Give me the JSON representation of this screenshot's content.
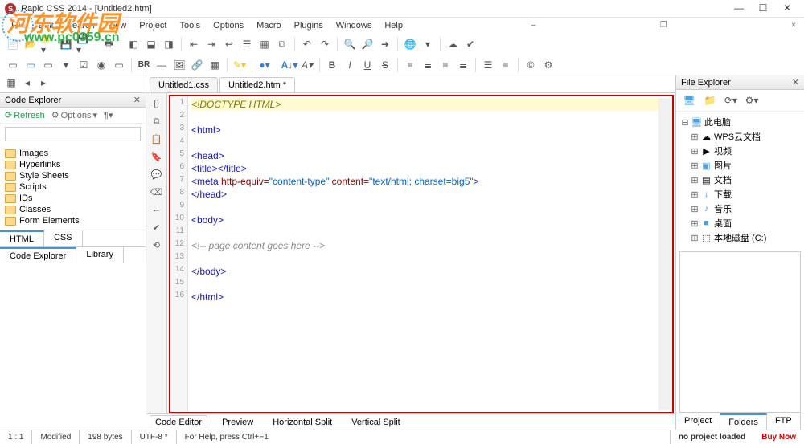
{
  "watermark": {
    "main": "河东软件园",
    "sub": "www.pc0359.cn"
  },
  "window": {
    "app_icon": "S",
    "title": "Rapid CSS 2014 - [Untitled2.htm]",
    "buttons": {
      "min": "—",
      "max": "☐",
      "close": "✕"
    },
    "subbuttons": {
      "min": "–",
      "max": "❐",
      "close": "×"
    }
  },
  "menus": [
    "File",
    "Edit",
    "Search",
    "View",
    "Project",
    "Tools",
    "Options",
    "Macro",
    "Plugins",
    "Windows",
    "Help"
  ],
  "file_tabs": [
    {
      "label": "Untitled1.css",
      "active": false
    },
    {
      "label": "Untitled2.htm *",
      "active": true
    }
  ],
  "code_explorer": {
    "title": "Code Explorer",
    "refresh": "Refresh",
    "options": "Options",
    "items": [
      "Images",
      "Hyperlinks",
      "Style Sheets",
      "Scripts",
      "IDs",
      "Classes",
      "Form Elements"
    ]
  },
  "left_tabs1": [
    "HTML",
    "CSS"
  ],
  "left_tabs2": [
    "Code Explorer",
    "Library"
  ],
  "file_explorer": {
    "title": "File Explorer",
    "root": "此电脑",
    "items": [
      {
        "label": "WPS云文档",
        "icon": "☁",
        "color": "#4aa0e0"
      },
      {
        "label": "视频",
        "icon": "▶",
        "color": "#666"
      },
      {
        "label": "图片",
        "icon": "▣",
        "color": "#4aa0e0"
      },
      {
        "label": "文档",
        "icon": "▤",
        "color": "#666"
      },
      {
        "label": "下载",
        "icon": "↓",
        "color": "#4aa0e0"
      },
      {
        "label": "音乐",
        "icon": "♪",
        "color": "#4aa0e0"
      },
      {
        "label": "桌面",
        "icon": "■",
        "color": "#4aa0e0"
      },
      {
        "label": "本地磁盘 (C:)",
        "icon": "⬚",
        "color": "#888"
      }
    ]
  },
  "right_tabs": [
    "Project",
    "Folders",
    "FTP"
  ],
  "center_tabs": [
    "Code Editor",
    "Preview",
    "Horizontal Split",
    "Vertical Split"
  ],
  "code": {
    "doctype": "<!DOCTYPE HTML>",
    "lines": [
      {
        "t": "html-open"
      },
      {
        "t": "blank"
      },
      {
        "t": "head-open"
      },
      {
        "t": "title"
      },
      {
        "t": "meta"
      },
      {
        "t": "head-close"
      },
      {
        "t": "blank"
      },
      {
        "t": "body-open"
      },
      {
        "t": "blank"
      },
      {
        "t": "comment"
      },
      {
        "t": "blank"
      },
      {
        "t": "body-close"
      },
      {
        "t": "blank"
      },
      {
        "t": "html-close"
      }
    ],
    "meta_attr1": "content-type",
    "meta_attr2": "text/html; charset=big5",
    "comment": "<!-- page content goes here -->"
  },
  "status": {
    "pos": "1 : 1",
    "state": "Modified",
    "size": "198 bytes",
    "enc": "UTF-8 *",
    "help": "For Help, press Ctrl+F1",
    "project": "no project loaded",
    "buy": "Buy Now"
  },
  "toolbar2_text": "BR"
}
